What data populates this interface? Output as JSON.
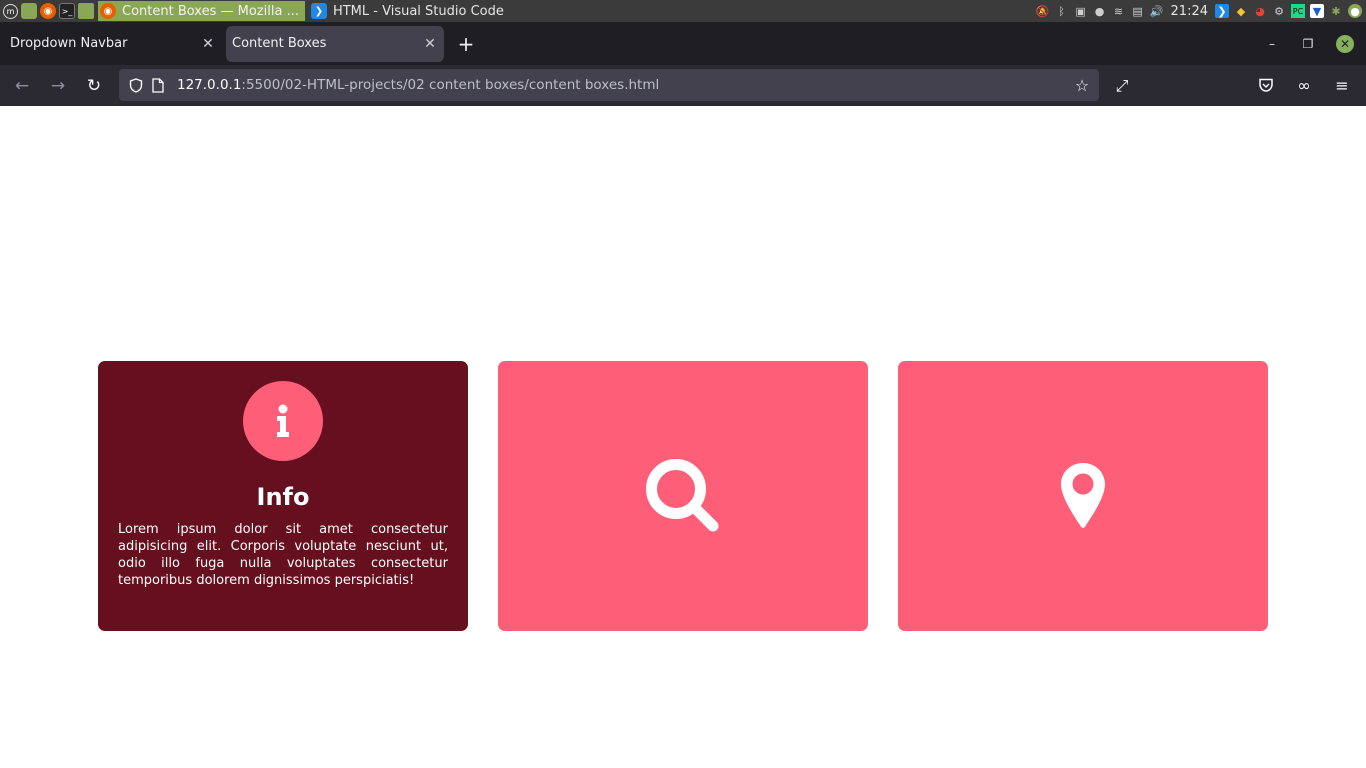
{
  "os_panel": {
    "windows": [
      {
        "label": "Content Boxes — Mozilla ...",
        "active": true
      },
      {
        "label": "HTML - Visual Studio Code",
        "active": false
      }
    ],
    "clock": "21:24"
  },
  "browser": {
    "tabs": [
      {
        "title": "Dropdown Navbar",
        "selected": false
      },
      {
        "title": "Content Boxes",
        "selected": true
      }
    ],
    "url_host": "127.0.0.1",
    "url_path": ":5500/02-HTML-projects/02 content boxes/content boxes.html"
  },
  "content": {
    "boxes": [
      {
        "icon": "info-icon",
        "title": "Info",
        "text": "Lorem ipsum dolor sit amet consectetur adipisicing elit. Corporis voluptate nesciunt ut, odio illo fuga nulla voluptates consectetur temporibus dolorem dignissimos perspiciatis!"
      },
      {
        "icon": "search-icon"
      },
      {
        "icon": "location-pin-icon"
      }
    ]
  },
  "colors": {
    "accent_pink": "#ff5e78",
    "info_box": "#660f1e",
    "os_active_window": "#8aa756"
  }
}
